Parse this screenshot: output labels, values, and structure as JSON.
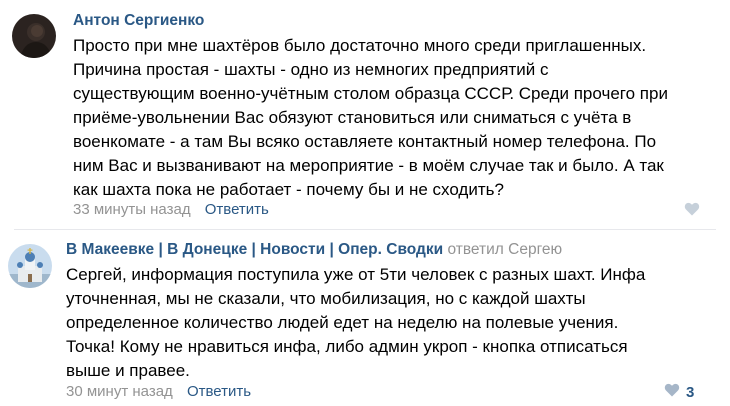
{
  "comments": [
    {
      "author": "Антон Сергиенко",
      "lines": [
        "Просто при мне шахтёров было достаточно много среди приглашенных.",
        "Причина простая - шахты - одно из немногих предприятий с",
        "существующим военно-учётным столом образца СССР. Среди прочего при",
        "приёме-увольнении Вас обязуют становиться или сниматься с учёта в",
        "военкомате - а там Вы всяко оставляете контактный номер телефона. По",
        "ним Вас и вызванивают на мероприятие - в моём случае так и было. А так",
        "как шахта пока не работает - почему бы и не сходить?"
      ],
      "time": "33 минуты назад",
      "reply_label": "Ответить",
      "like_count": ""
    },
    {
      "author_parts": [
        "В Макеевке",
        "В Донецке",
        "Новости",
        "Опер. Сводки"
      ],
      "separator": "|",
      "reply_to": "ответил Сергею",
      "lines": [
        "Сергей, информация поступила уже от 5ти человек с разных шахт. Инфа",
        "уточненная, мы не сказали, что мобилизация, но с каждой шахты",
        "определенное количество людей едет на неделю на полевые учения.",
        "Точка! Кому не нравиться инфа, либо админ укроп - кнопка отписаться",
        "выше и правее."
      ],
      "time": "30 минут назад",
      "reply_label": "Ответить",
      "like_count": "3"
    }
  ],
  "colors": {
    "link": "#2a5885",
    "meta": "#939393",
    "like_icon": "#a6b6c8"
  },
  "icons": {
    "like": "heart-icon"
  }
}
